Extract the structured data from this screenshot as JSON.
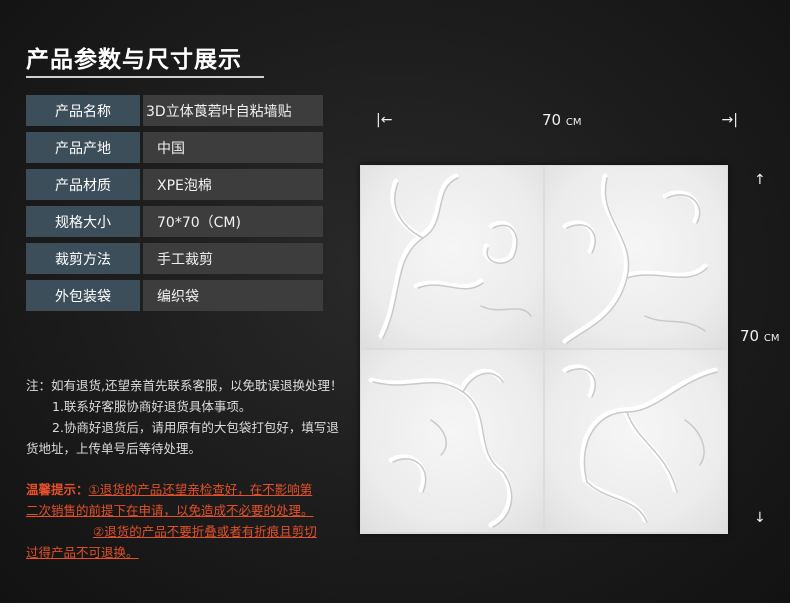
{
  "title": "产品参数与尺寸展示",
  "specs": [
    {
      "label": "产品名称",
      "value": "3D立体莨菪叶自粘墙贴"
    },
    {
      "label": "产品产地",
      "value": "中国"
    },
    {
      "label": "产品材质",
      "value": "XPE泡棉"
    },
    {
      "label": "规格大小",
      "value": "70*70（CM)"
    },
    {
      "label": "裁剪方法",
      "value": "手工裁剪"
    },
    {
      "label": "外包装袋",
      "value": "编织袋"
    }
  ],
  "notes": {
    "line1": "注：如有退货,还望亲首先联系客服，以免耽误退换处理！",
    "line2": "1.联系好客服协商好退货具体事项。",
    "line3": "2.协商好退货后，请用原有的大包袋打包好，填写退",
    "line4": "货地址，上传单号后等待处理。"
  },
  "warm_tip": {
    "label": "温馨提示：",
    "line1": "①退货的产品还望亲检查好，在不影响第",
    "line2": "二次销售的前提下在申请，以免造成不必要的处理。",
    "line3": "②退货的产品不要折叠或者有折痕且剪切",
    "line4": "过得产品不可退换。",
    "color": "#e4502a"
  },
  "dimensions": {
    "width_value": "70",
    "height_value": "70",
    "unit": "CM",
    "arrow_left": "|←",
    "arrow_right": "→|",
    "arrow_up": "↑",
    "arrow_down": "↓"
  },
  "colors": {
    "label_bg": "#3c4e5a",
    "value_bg": "#3d3d3d",
    "background": "#1c1c1c"
  }
}
